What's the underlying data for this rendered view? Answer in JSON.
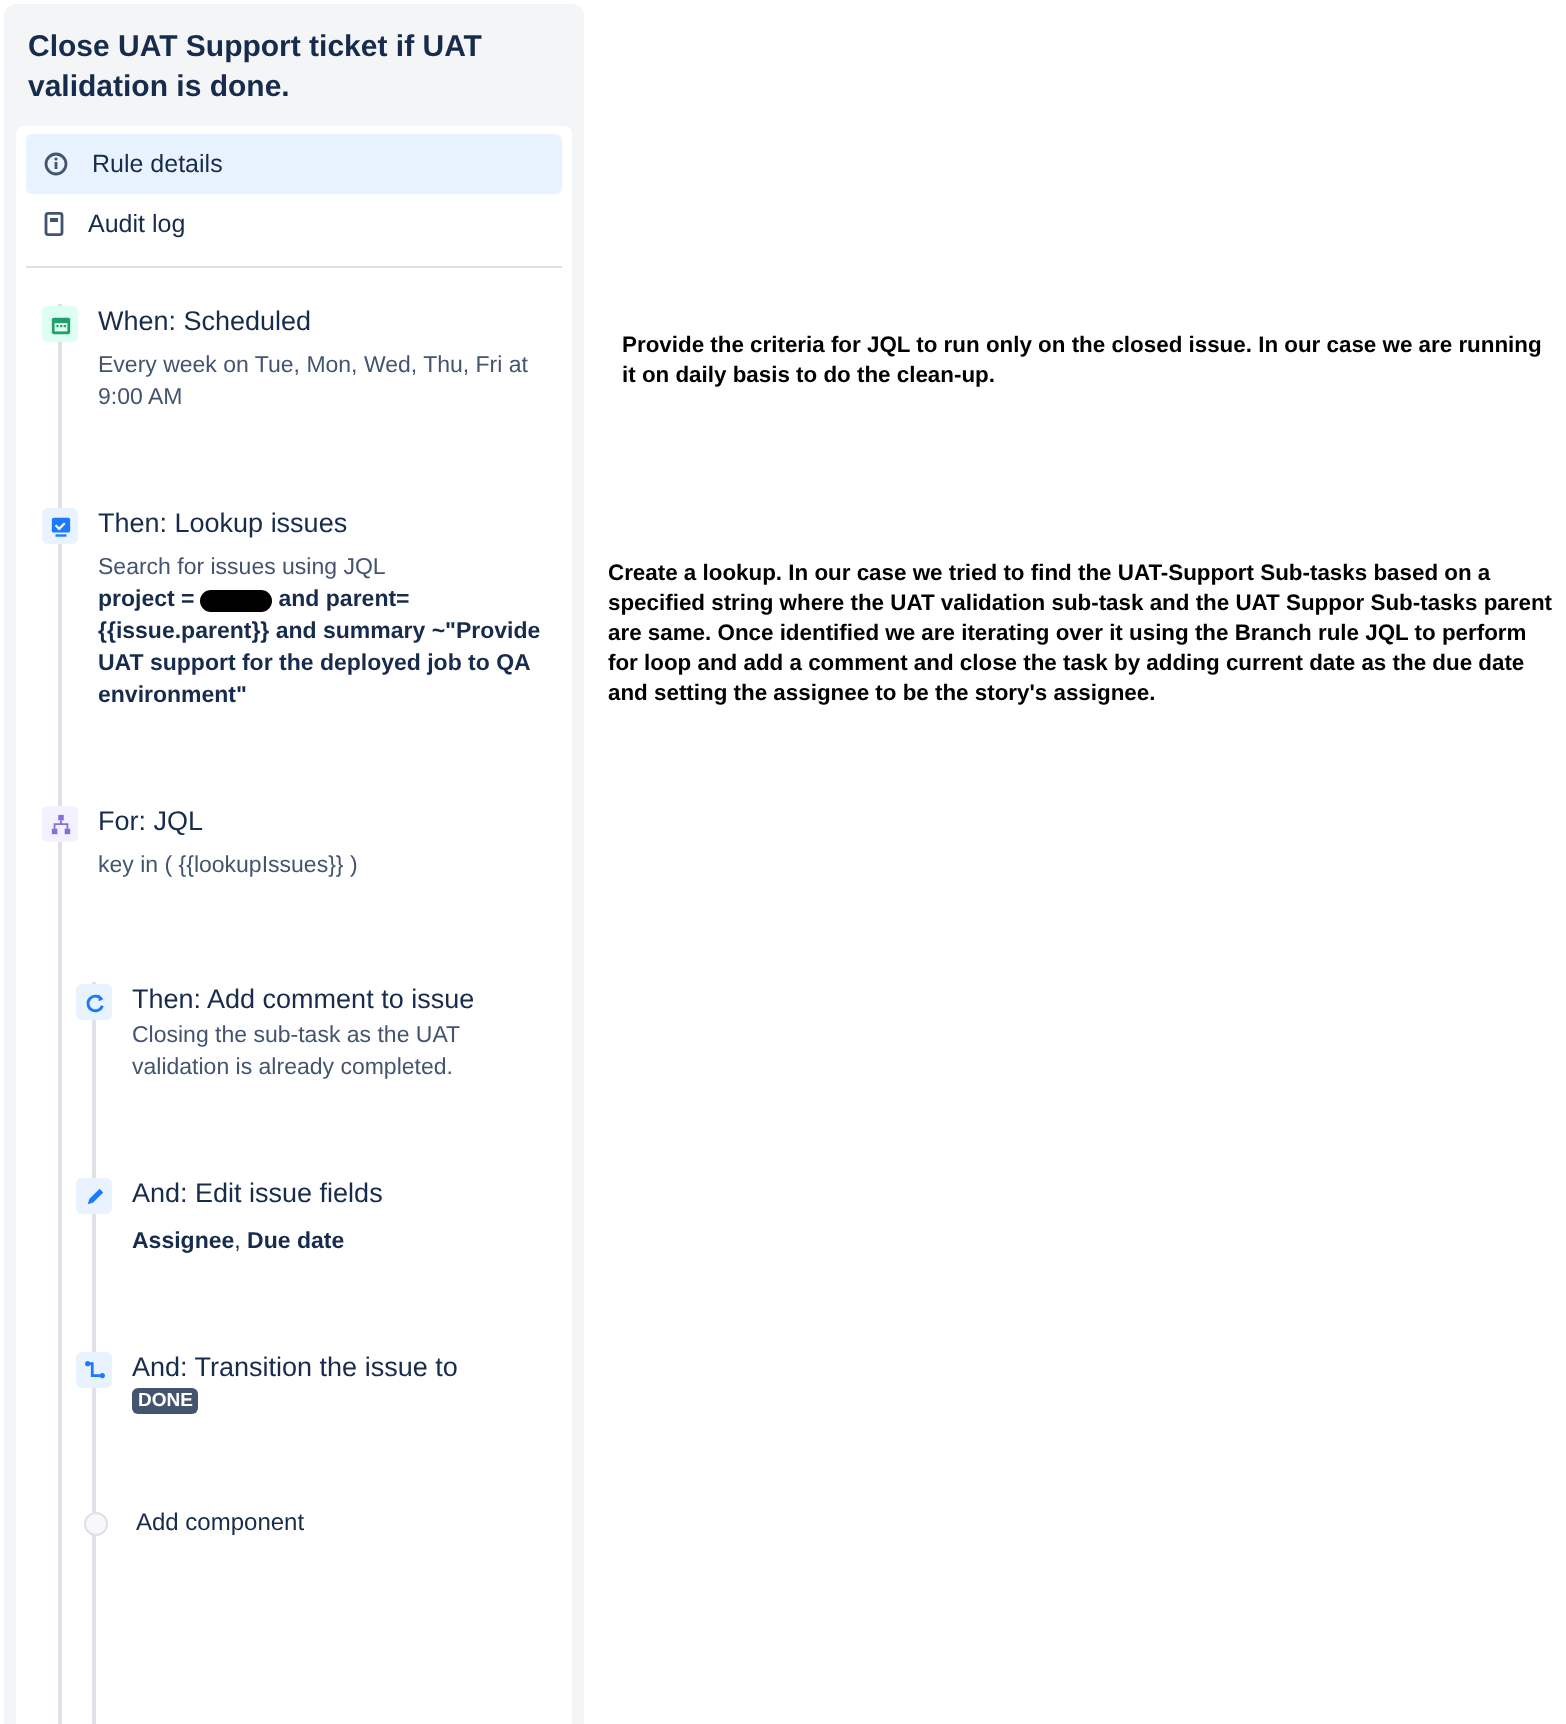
{
  "rule_title": "Close UAT Support ticket if UAT validation is done.",
  "nav": [
    {
      "label": "Rule details",
      "kind": "info",
      "selected": true
    },
    {
      "label": "Audit log",
      "kind": "log",
      "selected": false
    }
  ],
  "steps": [
    {
      "kind": "scheduled",
      "title": "When: Scheduled",
      "detail": "Every week on Tue, Mon, Wed, Thu, Fri at 9:00 AM"
    },
    {
      "kind": "lookup",
      "title": "Then: Lookup issues",
      "detail": "Search for issues using JQL",
      "query_before": "project =",
      "query_after": "and parent=",
      "query_rest": "{{issue.parent}} and summary ~\"Provide UAT support for the deployed job to QA environment\""
    },
    {
      "kind": "branch",
      "title": "For: JQL",
      "detail": "key in ( {{lookupIssues}} )",
      "children": [
        {
          "kind": "comment",
          "title": "Then: Add comment to issue",
          "detail": "Closing the sub-task as the UAT validation is already completed."
        },
        {
          "kind": "edit",
          "title": "And: Edit issue fields",
          "detail": "**Assignee**, **Due date**"
        },
        {
          "kind": "transition",
          "title": "And: Transition the issue to",
          "lozenge": "DONE"
        },
        {
          "kind": "add",
          "title": "Add component"
        }
      ]
    }
  ],
  "notes": [
    "Provide the criteria for JQL to run only on the closed issue. In our case we are running it on daily basis to do the clean-up.",
    "Create a lookup. In our case we tried to find the UAT-Support Sub-tasks based on a specified string where the UAT validation sub-task and the UAT Suppor Sub-tasks parent are same. Once identified we are iterating over it using the Branch rule JQL to perform for loop and add a comment and close the task by adding current date as the due date and setting the assignee to be the story's assignee."
  ]
}
